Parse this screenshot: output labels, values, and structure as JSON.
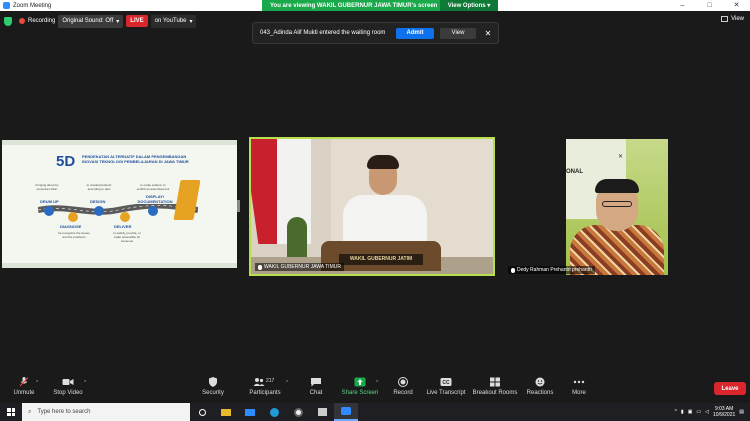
{
  "window": {
    "title": "Zoom Meeting",
    "controls": [
      "–",
      "□",
      "✕"
    ]
  },
  "share_banner": {
    "text": "You are viewing WAKIL GUBERNUR JAWA TIMUR's screen",
    "options_label": "View Options ▾"
  },
  "status": {
    "recording_label": "Recording",
    "sound_label": "Original Sound: Off",
    "live_label": "LIVE",
    "youtube_label": "on YouTube"
  },
  "view_label": "View",
  "waiting_room": {
    "message": "043_Adinda Alif Mukti entered the waiting room",
    "admit_label": "Admit",
    "view_label": "View",
    "close_symbol": "✕"
  },
  "slide": {
    "big_label": "5D",
    "title": "PENDEKATAN ALTERNATIF DALAM PENGEMBANGAN INOVASI TEKNOLOGI PEMBELAJARAN DI JAWA TIMUR",
    "steps": [
      {
        "label": "DRUM UP",
        "note": "bringing about by proceduct effort"
      },
      {
        "label": "DIAGNOSE",
        "note": "be recognize the issues and the problems"
      },
      {
        "label": "DESIGN",
        "note": "to create/construct according to plan"
      },
      {
        "label": "DELIVER",
        "note": "to satisfy, provide, or make accessible for someone"
      },
      {
        "label": "DISPLAY/ DOCUMENTATION",
        "note": "to make evident, to exhibit an advertisement"
      }
    ]
  },
  "main_video": {
    "nameplate": "WAKIL GUBERNUR JATIM",
    "participant": "WAKIL GUBERNUR JAWA TIMUR"
  },
  "right_video": {
    "partial_text": "ONAL",
    "participant": "Dedy Rahman Prehantri prehantri"
  },
  "toolbar": {
    "items": [
      {
        "label": "Unmute",
        "icon": "mic-off-icon"
      },
      {
        "label": "Stop Video",
        "icon": "video-icon"
      },
      {
        "label": "Security",
        "icon": "shield-icon"
      },
      {
        "label": "Participants",
        "icon": "participants-icon",
        "count": "217"
      },
      {
        "label": "Chat",
        "icon": "chat-icon"
      },
      {
        "label": "Share Screen",
        "icon": "share-screen-icon"
      },
      {
        "label": "Record",
        "icon": "record-icon"
      },
      {
        "label": "Live Transcript",
        "icon": "cc-icon"
      },
      {
        "label": "Breakout Rooms",
        "icon": "breakout-icon"
      },
      {
        "label": "Reactions",
        "icon": "reactions-icon"
      },
      {
        "label": "More",
        "icon": "more-icon"
      }
    ],
    "leave_label": "Leave"
  },
  "taskbar": {
    "search_placeholder": "Type here to search",
    "time": "9:03 AM",
    "date": "10/9/2021"
  },
  "colors": {
    "accent_blue": "#0e72ed",
    "share_green": "#19a84a",
    "live_red": "#d9262c",
    "speaker_border": "#b8e04d"
  }
}
